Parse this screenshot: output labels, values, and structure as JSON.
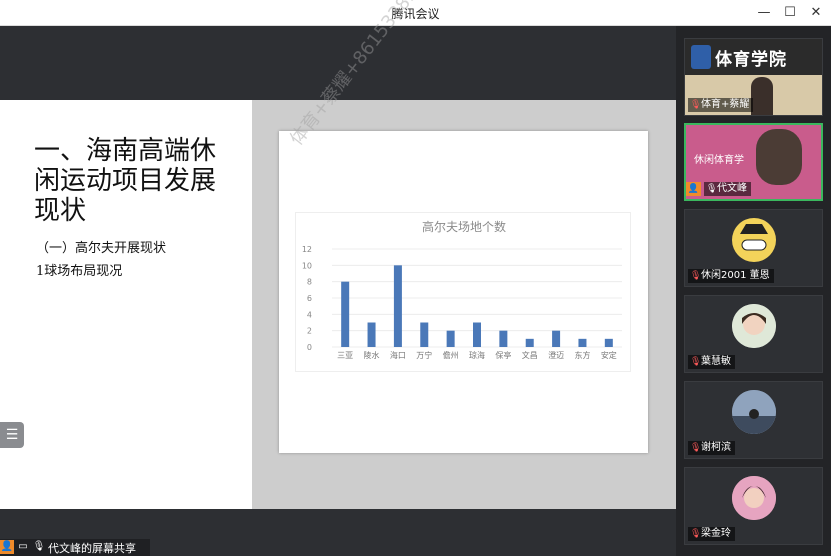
{
  "window": {
    "title": "腾讯会议",
    "min_label": "—",
    "max_label": "☐",
    "close_label": "✕"
  },
  "slide": {
    "title": "一、海南高端休闲运动项目发展现状",
    "subtitle1": "（一）高尔夫开展现状",
    "subtitle2": "1球场布局现况",
    "list_toggle_label": "☰"
  },
  "watermark": {
    "text": "体育+蔡耀+8615338913891"
  },
  "chart_data": {
    "type": "bar",
    "title": "高尔夫场地个数",
    "categories": [
      "三亚",
      "陵水",
      "海口",
      "万宁",
      "儋州",
      "琼海",
      "保亭",
      "文昌",
      "澄迈",
      "东方",
      "安定"
    ],
    "values": [
      8,
      3,
      10,
      3,
      2,
      3,
      2,
      1,
      2,
      1,
      1
    ],
    "ylim": [
      0,
      12
    ],
    "yticks": [
      "0",
      "2",
      "4",
      "6",
      "8",
      "10",
      "12"
    ],
    "grid": true,
    "color": "#4a78b8"
  },
  "share": {
    "label": "代文峰的屏幕共享"
  },
  "participants": [
    {
      "name": "体育+蔡耀",
      "mic": "muted",
      "banner": "体育学院",
      "active": false
    },
    {
      "name": "代文峰",
      "mic": "on",
      "banner": "休闲体育学",
      "active": true,
      "host": true
    },
    {
      "name": "休闲2001 董恩",
      "mic": "muted",
      "active": false
    },
    {
      "name": "葉慧敏",
      "mic": "muted",
      "active": false
    },
    {
      "name": "谢柯滨",
      "mic": "muted",
      "active": false
    },
    {
      "name": "梁金玲",
      "mic": "muted",
      "active": false
    }
  ],
  "colors": {
    "accent_active": "#3bb75e",
    "host_badge": "#f08b2a",
    "mic_muted": "#ff5a5a"
  }
}
